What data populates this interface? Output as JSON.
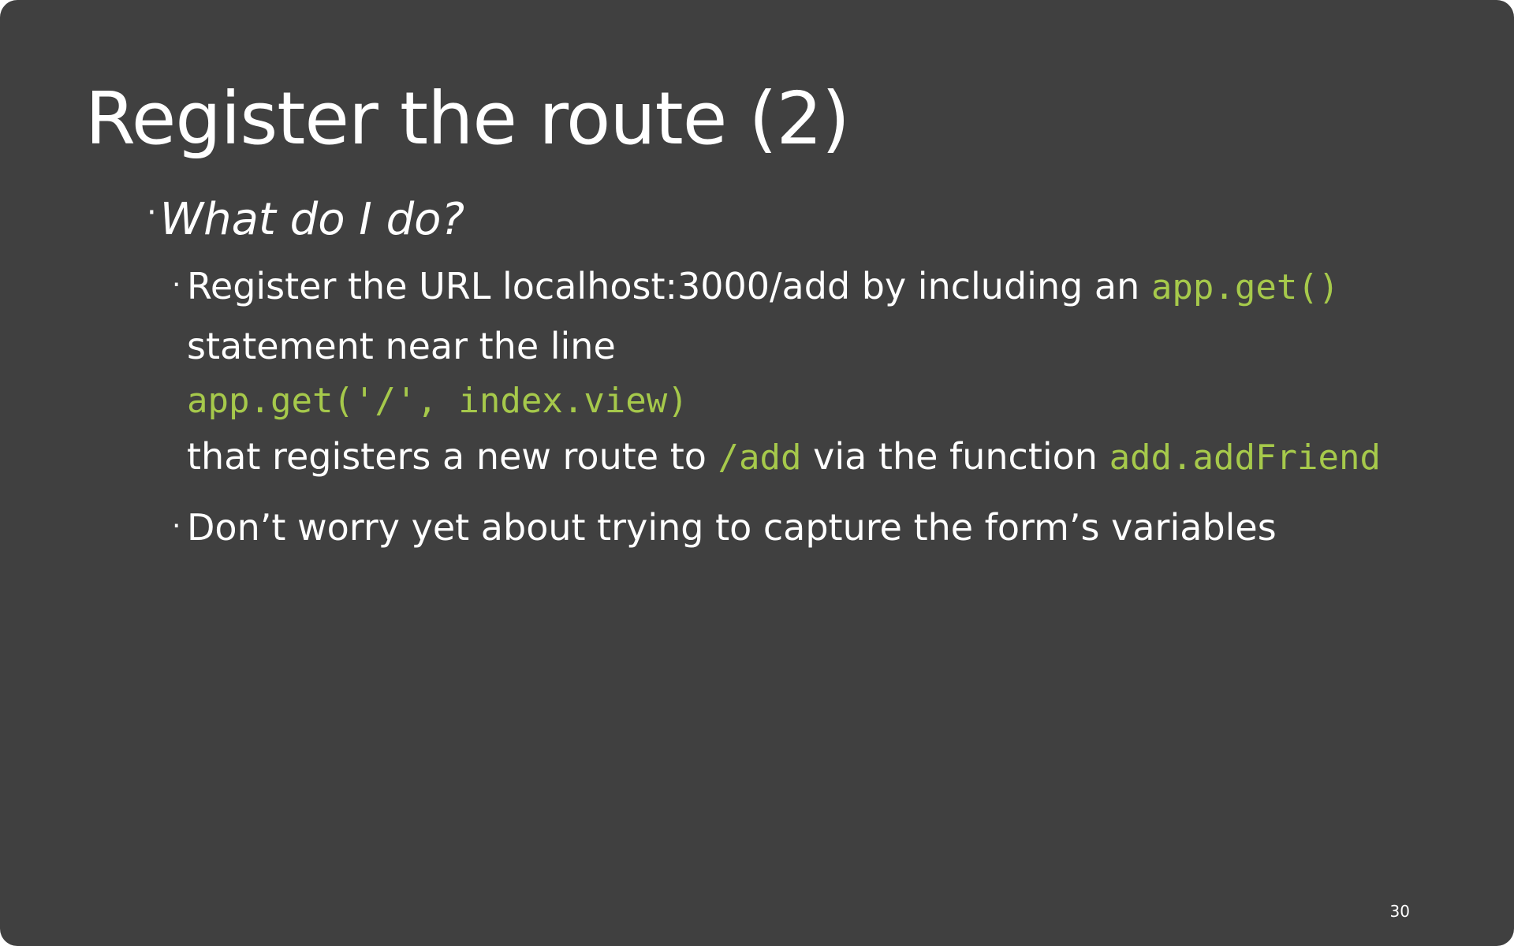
{
  "slide": {
    "title": "Register the route (2)",
    "bullet_l1": "What do I do?",
    "line1_text": "Register the URL localhost:3000/add by including an",
    "line1_code": "app.get()",
    "line2_text": "statement near the line",
    "line3_code": "app.get('/', index.view)",
    "line4_text_a": "that registers a new route to",
    "line4_code_a": "/add",
    "line4_text_b": "via the function",
    "line4_code_b": "add.addFriend",
    "bullet2_text": "Don’t worry yet about trying to capture the form’s variables",
    "page_number": "30"
  },
  "colors": {
    "background": "#404040",
    "text": "#ffffff",
    "code": "#a6c94b"
  }
}
